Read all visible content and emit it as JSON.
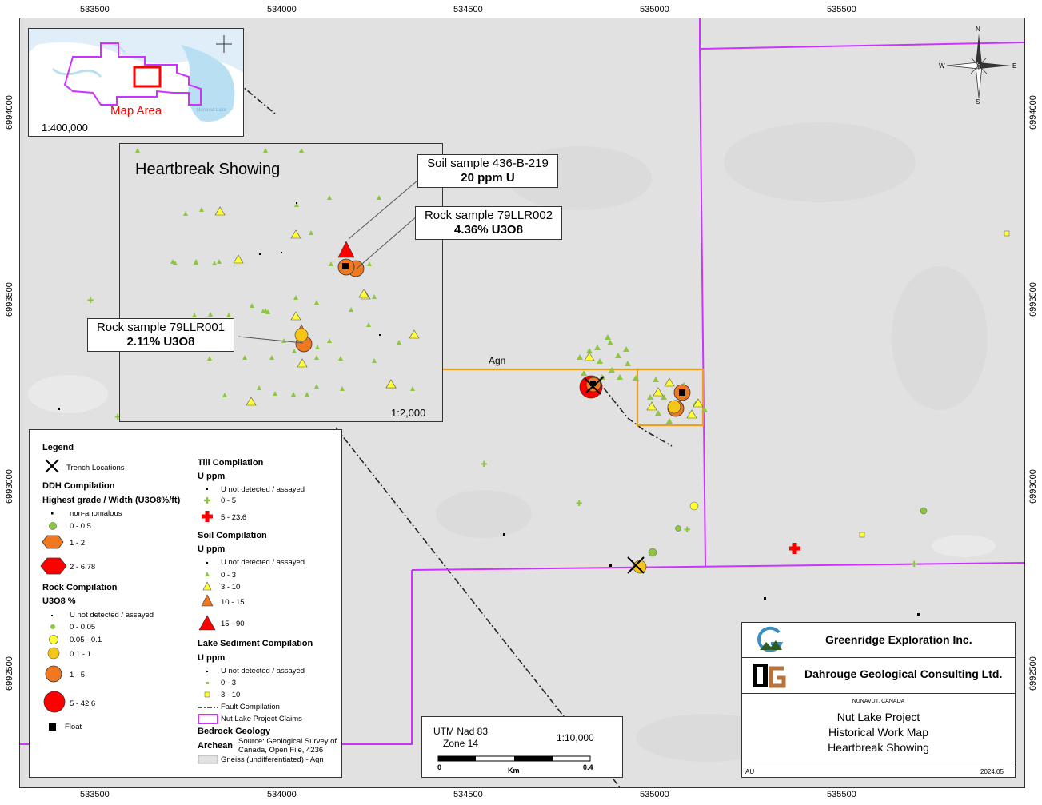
{
  "map": {
    "x_ticks": [
      "533500",
      "534000",
      "534500",
      "535000",
      "535500"
    ],
    "y_ticks": [
      "6994000",
      "6993500",
      "6993000",
      "6992500"
    ],
    "colors": {
      "background": "#e1e1e1",
      "claims": "#cc33ff",
      "agn": "#e8a020",
      "rock_high": "#ff0000",
      "rock_mid": "#f07820",
      "rock_low": "#f5c518",
      "soil_low": "#8dc63f",
      "soil_mid": "#ffff33"
    }
  },
  "inset_overview": {
    "label": "Map Area",
    "scale": "1:400,000"
  },
  "detail_inset": {
    "title": "Heartbreak Showing",
    "scale": "1:2,000"
  },
  "callouts": {
    "soil": {
      "line1": "Soil sample 436-B-219",
      "line2": "20 ppm U"
    },
    "rock2": {
      "line1": "Rock sample 79LLR002",
      "line2": "4.36% U3O8"
    },
    "rock1": {
      "line1": "Rock sample 79LLR001",
      "line2": "2.11% U3O8"
    }
  },
  "map_labels": {
    "agn": "Agn"
  },
  "legend": {
    "title": "Legend",
    "trench": "Trench Locations",
    "ddh_title": "DDH Compilation",
    "ddh_sub": "Highest grade / Width (U3O8%/ft)",
    "ddh_items": [
      "non-anomalous",
      "0 - 0.5",
      "1 - 2",
      "2 - 6.78"
    ],
    "rock_title": "Rock Compilation",
    "rock_sub": "U3O8 %",
    "rock_items": [
      "U not detected / assayed",
      "0 - 0.05",
      "0.05 - 0.1",
      "0.1 - 1",
      "1 - 5",
      "5 - 42.6"
    ],
    "float": "Float",
    "till_title": "Till Compilation",
    "till_sub": "U ppm",
    "till_items": [
      "U not detected / assayed",
      "0 - 5",
      "5 - 23.6"
    ],
    "soil_title": "Soil Compilation",
    "soil_sub": "U ppm",
    "soil_items": [
      "U not detected / assayed",
      "0 - 3",
      "3 - 10",
      "10 - 15",
      "15 - 90"
    ],
    "lake_title": "Lake Sediment Compilation",
    "lake_sub": "U ppm",
    "lake_items": [
      "U not detected / assayed",
      "0 - 3",
      "3 - 10"
    ],
    "fault": "Fault Compilation",
    "claims": "Nut Lake Project Claims",
    "bedrock_title": "Bedrock Geology",
    "archean": "Archean",
    "source": "Source: Geological Survey of Canada, Open File, 4236",
    "gneiss": "Gneiss (undifferentiated) - Agn"
  },
  "scalebar": {
    "datum": "UTM Nad 83",
    "zone": "Zone 14",
    "scale": "1:10,000",
    "zero": "0",
    "unit": "Km",
    "max": "0.4"
  },
  "titleblock": {
    "company1": "Greenridge Exploration Inc.",
    "company2": "Dahrouge Geological Consulting Ltd.",
    "region": "NUNAVUT, CANADA",
    "line1": "Nut Lake Project",
    "line2": "Historical Work Map",
    "line3": "Heartbreak Showing",
    "author": "AU",
    "date": "2024.05"
  },
  "compass": {
    "n": "N",
    "s": "S",
    "e": "E",
    "w": "W"
  }
}
